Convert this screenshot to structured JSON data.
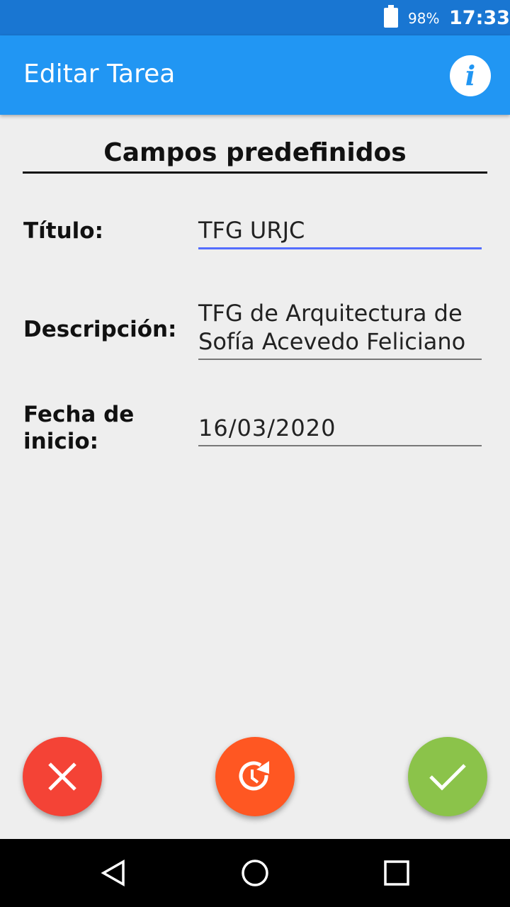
{
  "status": {
    "battery": "98%",
    "time": "17:33"
  },
  "appbar": {
    "title": "Editar Tarea",
    "info_icon": "i"
  },
  "section": {
    "title": "Campos predefinidos"
  },
  "form": {
    "titulo": {
      "label": "Título:",
      "value": "TFG URJC"
    },
    "descripcion": {
      "label": "Descripción:",
      "value_line1": "TFG de Arquitectura de",
      "value_line2": "Sofía Acevedo Feliciano"
    },
    "fecha": {
      "label_line1": "Fecha de",
      "label_line2": "inicio:",
      "value": "16/03/2020"
    }
  },
  "colors": {
    "cancel": "#f44336",
    "reset": "#ff5722",
    "confirm": "#8bc34a",
    "accent": "#2196f3"
  }
}
